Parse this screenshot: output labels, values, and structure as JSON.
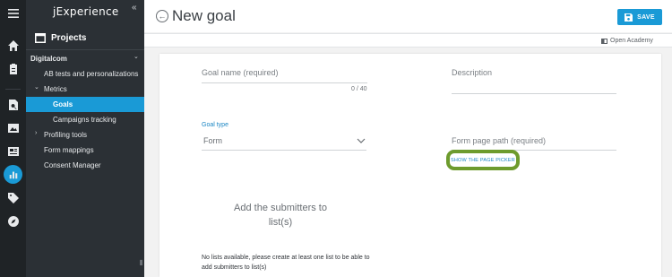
{
  "app": {
    "logo": "jExperience",
    "collapse_glyph": "«",
    "grip_glyph": "⦀"
  },
  "rail": {
    "icons": [
      "menu-icon",
      "home-icon",
      "clipboard-icon",
      "document-search-icon",
      "image-icon",
      "newspaper-icon",
      "analytics-icon",
      "tag-icon",
      "compass-icon"
    ],
    "active": "analytics-icon"
  },
  "sidebar": {
    "projects_label": "Projects",
    "items": [
      {
        "label": "Digitalcom",
        "arrow": "⌄"
      },
      {
        "label": "AB tests and personalizations"
      },
      {
        "label": "Metrics",
        "arrow": "⌄"
      },
      {
        "label": "Goals",
        "active": true
      },
      {
        "label": "Campaigns tracking"
      },
      {
        "label": "Profiling tools",
        "arrow": "›"
      },
      {
        "label": "Form mappings"
      },
      {
        "label": "Consent Manager"
      }
    ]
  },
  "header": {
    "back_glyph": "←",
    "title": "New goal",
    "save_label": "SAVE",
    "academy_label": "Open Academy"
  },
  "form": {
    "goal_name_label": "Goal name (required)",
    "goal_name_counter": "0 / 40",
    "description_label": "Description",
    "goal_type_label": "Goal type",
    "goal_type_value": "Form",
    "form_page_path_label": "Form page path (required)",
    "page_picker_label": "SHOW THE PAGE PICKER",
    "submitters_label": "Add the submitters to list(s)",
    "no_lists_message": "No lists available, please create at least one list to be able to add submitters to list(s)"
  },
  "colors": {
    "accent": "#1a9ad6",
    "rail_bg": "#1f2326",
    "sidebar_bg": "#2b3035",
    "highlight_ring": "#6d9b2d"
  }
}
